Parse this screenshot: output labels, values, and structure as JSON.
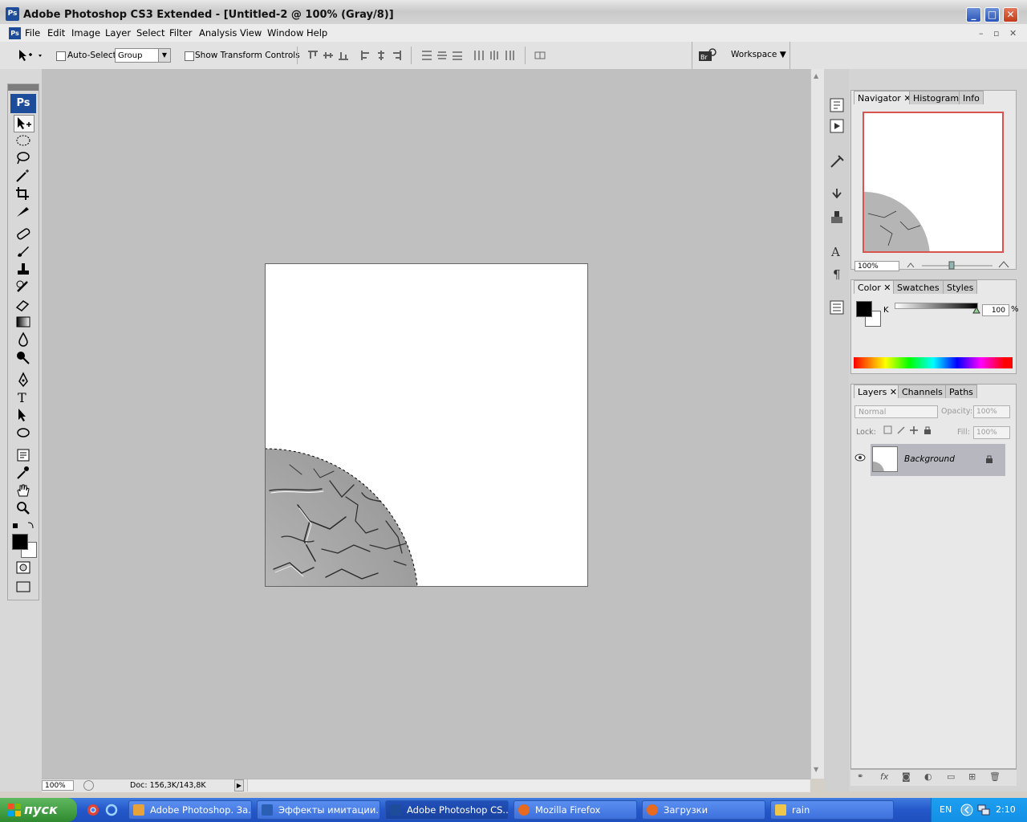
{
  "window": {
    "title": "Adobe Photoshop CS3 Extended - [Untitled-2 @ 100% (Gray/8)]",
    "icon_label": "Ps",
    "minimize_label": "_",
    "maximize_label": "□",
    "close_label": "✕"
  },
  "menu": {
    "items": [
      "File",
      "Edit",
      "Image",
      "Layer",
      "Select",
      "Filter",
      "Analysis",
      "View",
      "Window",
      "Help"
    ]
  },
  "options_bar": {
    "auto_select_label": "Auto-Select:",
    "auto_select_value": "Group",
    "show_transform_label": "Show Transform Controls",
    "workspace_label": "Workspace ▼"
  },
  "toolbox": {
    "logo": "Ps",
    "tools": [
      "move-tool",
      "marquee-tool",
      "lasso-tool",
      "magic-wand-tool",
      "crop-tool",
      "slice-tool",
      "healing-tool",
      "brush-tool",
      "clone-stamp-tool",
      "history-brush-tool",
      "eraser-tool",
      "gradient-tool",
      "blur-tool",
      "dodge-tool",
      "pen-tool",
      "type-tool",
      "path-select-tool",
      "shape-tool",
      "notes-tool",
      "eyedropper-tool",
      "hand-tool",
      "zoom-tool"
    ]
  },
  "status_bar": {
    "zoom": "100%",
    "doc_info": "Doc: 156,3K/143,8K"
  },
  "navigator": {
    "tabs": [
      "Navigator",
      "Histogram",
      "Info"
    ],
    "zoom": "100%"
  },
  "color_panel": {
    "tabs": [
      "Color",
      "Swatches",
      "Styles"
    ],
    "channel_label": "K",
    "channel_value": "100",
    "unit": "%"
  },
  "layers_panel": {
    "tabs": [
      "Layers",
      "Channels",
      "Paths"
    ],
    "blend_mode": "Normal",
    "opacity_label": "Opacity:",
    "opacity_value": "100%",
    "lock_label": "Lock:",
    "fill_label": "Fill:",
    "fill_value": "100%",
    "layers": [
      {
        "name": "Background",
        "visible": true,
        "locked": true
      }
    ]
  },
  "taskbar": {
    "start_label": "пуск",
    "tasks": [
      {
        "label": "Adobe Photoshop. За...",
        "icon_color": "#e8a23a",
        "active": false
      },
      {
        "label": "Эффекты имитации...",
        "icon_color": "#2b5fb4",
        "active": false
      },
      {
        "label": "Adobe Photoshop CS...",
        "icon_color": "#1d4c9b",
        "active": true
      },
      {
        "label": "Mozilla Firefox",
        "icon_color": "#e66a1f",
        "active": false
      },
      {
        "label": "Загрузки",
        "icon_color": "#e66a1f",
        "active": false
      },
      {
        "label": "rain",
        "icon_color": "#f0c64a",
        "active": false
      }
    ],
    "lang": "EN",
    "clock": "2:10"
  },
  "colors": {
    "workspace_bg": "#c0c0c0",
    "accent_blue": "#1d4c9b",
    "taskbar_blue": "#2457c9",
    "start_green": "#2f8a2f",
    "navigator_frame": "#d9534f"
  }
}
